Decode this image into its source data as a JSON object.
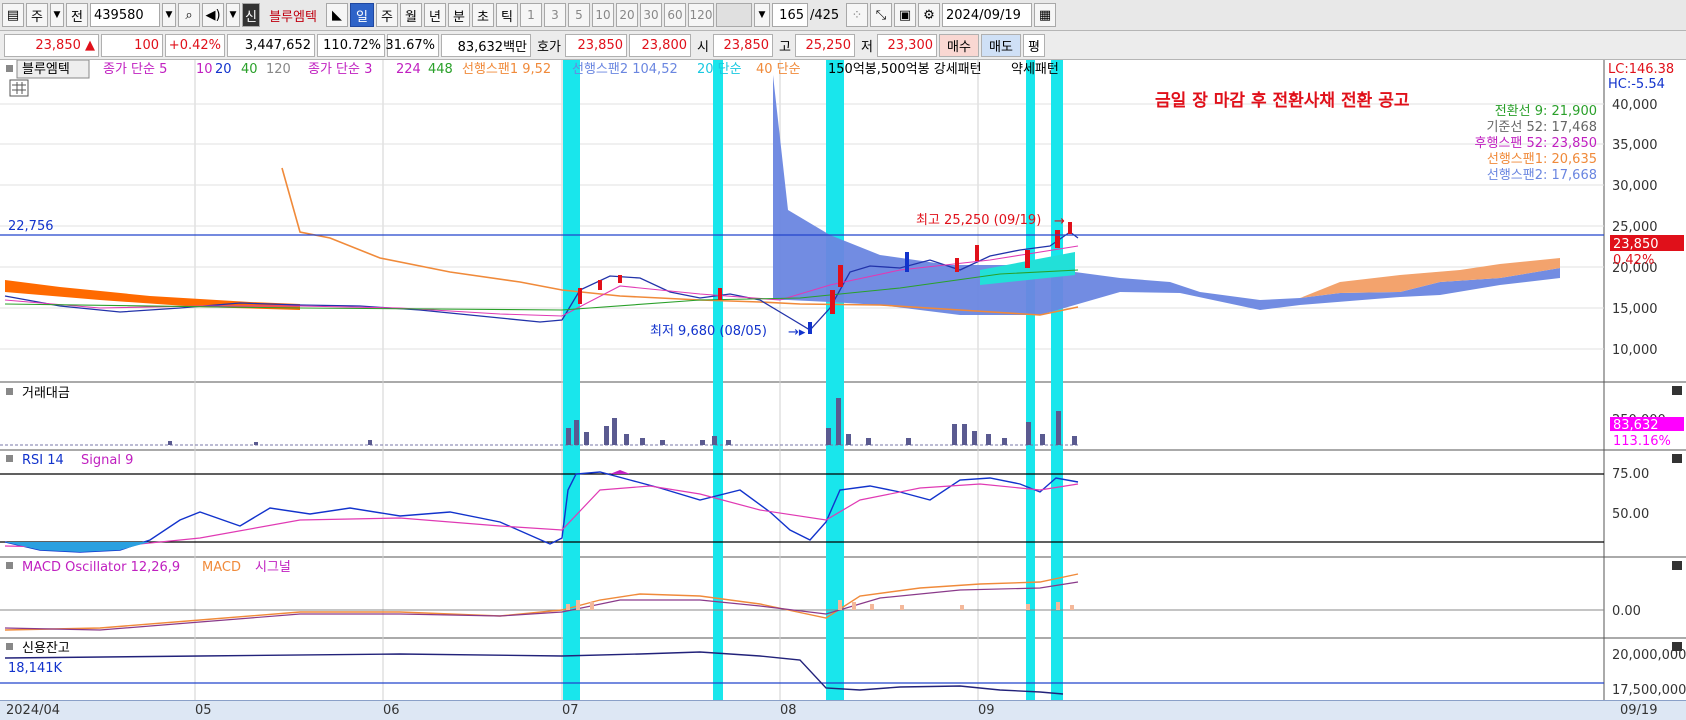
{
  "toolbar": {
    "unit_label": "주",
    "prev_label": "전",
    "code": "439580",
    "name_badge": "신",
    "stock_name": "블루엠텍",
    "periods": [
      "일",
      "주",
      "월",
      "년",
      "분",
      "초",
      "틱"
    ],
    "active_period": "일",
    "intervals": [
      "1",
      "3",
      "5",
      "10",
      "20",
      "30",
      "60",
      "120"
    ],
    "count": "165",
    "total": "/425",
    "date": "2024/09/19"
  },
  "quote": {
    "price": "23,850 ▲",
    "change": "100",
    "change_pct": "+0.42%",
    "volume": "3,447,652",
    "vol_ratio": "110.72%",
    "turnover": "31.67%",
    "amount": "83,632백만",
    "hoga_label": "호가",
    "ask": "23,850",
    "bid": "23,800",
    "open_label": "시",
    "open": "23,850",
    "high_label": "고",
    "high": "25,250",
    "low_label": "저",
    "low": "23,300",
    "buy_label": "매수",
    "sell_label": "매도",
    "eval_label": "평"
  },
  "legend": {
    "name": "블루엠텍",
    "ma1_label": "종가 단순 5",
    "ma1_vals": [
      "10",
      "20",
      "40",
      "120"
    ],
    "ma2_label": "종가 단순 3",
    "ma2_vals": [
      "224",
      "448"
    ],
    "span1": "선행스팬1 9,52",
    "span2": "선행스팬2 104,52",
    "s20": "20 단순",
    "s40": "40 단순",
    "pattern": "150억봉,500억봉 강세패턴",
    "weak": "약세패턴"
  },
  "right_labels": {
    "lc": "LC:146.38",
    "hc": "HC:-5.54",
    "tenkan": "전환선 9: 21,900",
    "kijun": "기준선 52: 17,468",
    "chikou": "후행스팬 52: 23,850",
    "senkou1": "선행스팬1: 20,635",
    "senkou2": "선행스팬2: 17,668",
    "price_tag": "23,850",
    "pct_tag": "0.42%",
    "volume_tag": "83,632",
    "vol_pct_tag": "113.16%"
  },
  "annotations": {
    "notice": "금일 장 마감 후 전환사채 전환 공고",
    "high_mark": "최고 25,250 (09/19)",
    "low_mark": "최저 9,680 (08/05)",
    "hline_value": "22,756"
  },
  "panels": {
    "volume_title": "거래대금",
    "rsi_title": "RSI 14",
    "rsi_signal": "Signal 9",
    "macd_title": "MACD Oscillator 12,26,9",
    "macd_line": "MACD",
    "macd_signal": "시그널",
    "credit_title": "신용잔고",
    "credit_value": "18,141K"
  },
  "y_axes": {
    "price": [
      "40,000",
      "35,000",
      "30,000",
      "25,000",
      "20,000",
      "15,000",
      "10,000"
    ],
    "volume": [
      "250,000"
    ],
    "rsi": [
      "75.00",
      "50.00"
    ],
    "macd": [
      "0.00"
    ],
    "credit": [
      "20,000,000",
      "17,500,000"
    ]
  },
  "x_axis": [
    "2024/04",
    "05",
    "06",
    "07",
    "08",
    "09",
    "09/19"
  ],
  "chart_data": {
    "type": "line",
    "title": "블루엠텍",
    "price_axis_range": [
      8000,
      42000
    ],
    "hline": 22756,
    "close_approx": [
      14500,
      14000,
      13600,
      13400,
      13300,
      13200,
      13300,
      13400,
      13200,
      13000,
      12900,
      12800,
      12400,
      12200,
      11800,
      11000,
      14500,
      16500,
      17000,
      16000,
      15200,
      14800,
      14600,
      15000,
      14400,
      14200,
      13800,
      13500,
      12000,
      11200,
      10000,
      13500,
      19000,
      18500,
      18000,
      18200,
      17800,
      19000,
      18000,
      17500,
      18500,
      20500,
      21500,
      21000,
      20500,
      19500,
      21000,
      22000,
      23500,
      23850
    ],
    "rsi_range": [
      25,
      80
    ],
    "credit_range": [
      17000000,
      21000000
    ]
  }
}
